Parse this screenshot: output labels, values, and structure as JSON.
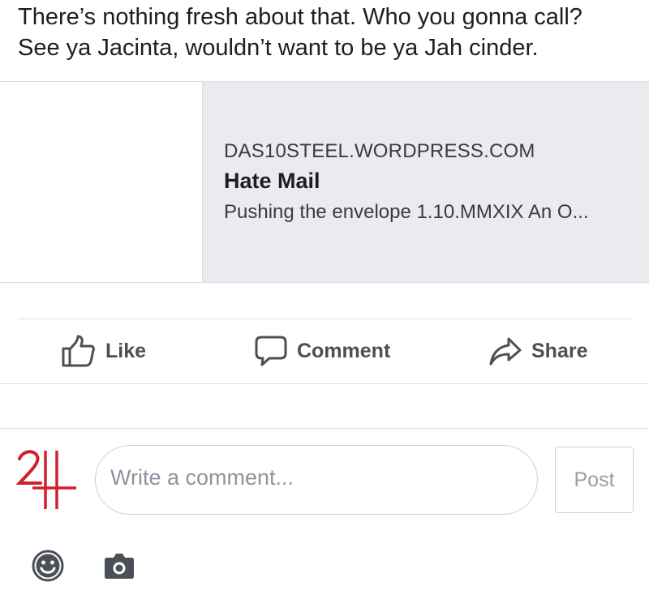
{
  "post": {
    "line1": "There’s nothing fresh about that. Who you gonna call?",
    "line2": "See ya Jacinta, wouldn’t want to be ya Jah cinder."
  },
  "link_preview": {
    "domain": "DAS10STEEL.WORDPRESS.COM",
    "title": "Hate Mail",
    "description": "Pushing the envelope 1.10.MMXIX An O..."
  },
  "actions": {
    "like": "Like",
    "comment": "Comment",
    "share": "Share",
    "icon_color": "#4b4f56"
  },
  "composer": {
    "placeholder": "Write a comment...",
    "post_label": "Post",
    "avatar_color": "#d0202f"
  },
  "icons": {
    "emoji": "smiley-icon",
    "camera": "camera-icon"
  }
}
